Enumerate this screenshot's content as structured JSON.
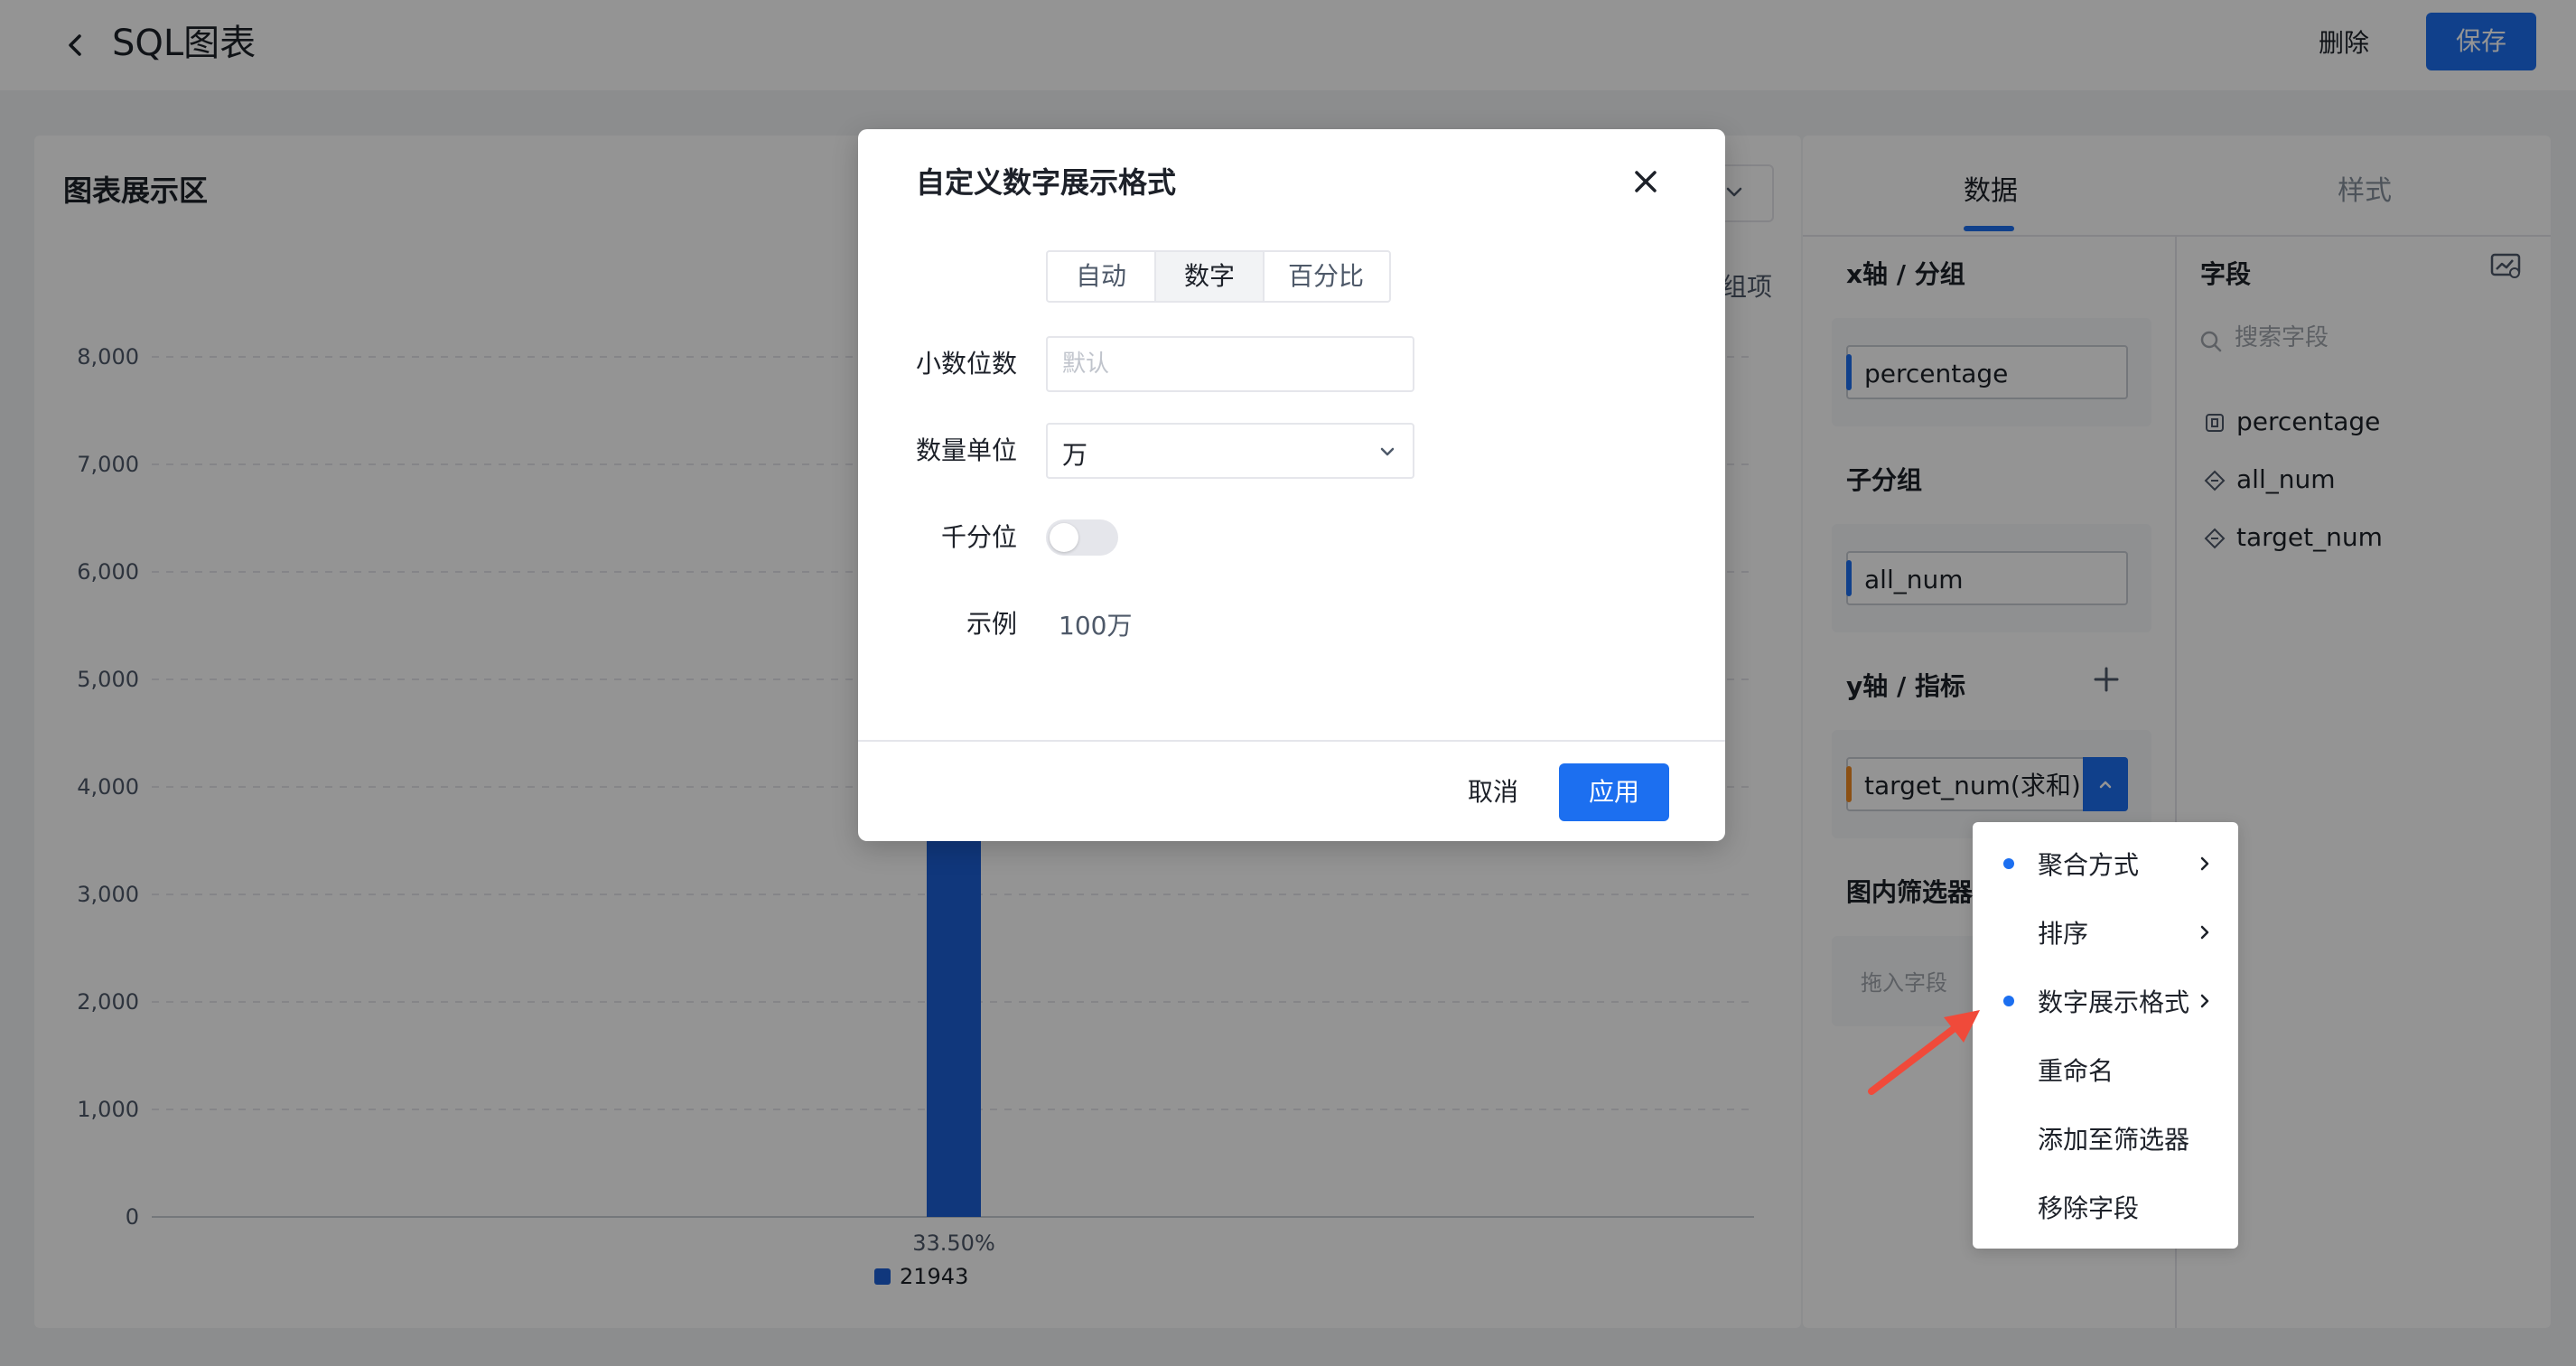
{
  "header": {
    "title": "SQL图表",
    "delete_label": "删除",
    "save_label": "保存"
  },
  "chart_area": {
    "title": "图表展示区",
    "group_hint": "组项"
  },
  "chart_data": {
    "type": "bar",
    "categories": [
      "33.50%"
    ],
    "series": [
      {
        "name": "21943",
        "values": [
          21943
        ],
        "color": "#1c5fd6"
      }
    ],
    "y_ticks": [
      0,
      1000,
      2000,
      3000,
      4000,
      5000,
      6000,
      7000,
      8000
    ],
    "y_tick_labels": [
      "0",
      "1,000",
      "2,000",
      "3,000",
      "4,000",
      "5,000",
      "6,000",
      "7,000",
      "8,000"
    ],
    "ylim": [
      0,
      8000
    ],
    "grid": true,
    "legend": "bottom-center"
  },
  "right_panel": {
    "tabs": [
      {
        "label": "数据",
        "active": true
      },
      {
        "label": "样式",
        "active": false
      }
    ],
    "x_axis": {
      "label": "x轴 / 分组",
      "field": "percentage"
    },
    "sub_group": {
      "label": "子分组",
      "field": "all_num"
    },
    "y_axis": {
      "label": "y轴 / 指标",
      "field": "target_num(求和)"
    },
    "filter": {
      "label": "图内筛选器",
      "drop_hint": "拖入字段"
    },
    "fields": {
      "label": "字段",
      "search_placeholder": "搜索字段",
      "items": [
        {
          "name": "percentage",
          "icon": "text-field-icon"
        },
        {
          "name": "all_num",
          "icon": "numeric-field-icon"
        },
        {
          "name": "target_num",
          "icon": "numeric-field-icon"
        }
      ]
    }
  },
  "context_menu": {
    "items": [
      {
        "label": "聚合方式",
        "dot": true,
        "submenu": true
      },
      {
        "label": "排序",
        "dot": false,
        "submenu": true
      },
      {
        "label": "数字展示格式",
        "dot": true,
        "submenu": true
      },
      {
        "label": "重命名",
        "dot": false,
        "submenu": false
      },
      {
        "label": "添加至筛选器",
        "dot": false,
        "submenu": false
      },
      {
        "label": "移除字段",
        "dot": false,
        "submenu": false
      }
    ]
  },
  "modal": {
    "title": "自定义数字展示格式",
    "format_tabs": [
      {
        "label": "自动",
        "selected": false
      },
      {
        "label": "数字",
        "selected": true
      },
      {
        "label": "百分比",
        "selected": false
      }
    ],
    "decimals": {
      "label": "小数位数",
      "placeholder": "默认",
      "value": ""
    },
    "unit": {
      "label": "数量单位",
      "value": "万"
    },
    "thousands": {
      "label": "千分位",
      "enabled": false
    },
    "example": {
      "label": "示例",
      "value": "100万"
    },
    "cancel_label": "取消",
    "apply_label": "应用"
  },
  "colors": {
    "primary": "#1c6ff0",
    "bar": "#1c5fd6",
    "accent_orange": "#f08a24",
    "arrow": "#f04a3a"
  }
}
